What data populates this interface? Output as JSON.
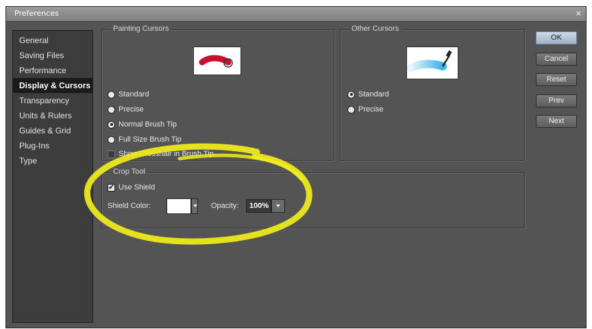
{
  "window": {
    "title": "Preferences",
    "close_glyph": "×"
  },
  "sidebar": {
    "items": [
      {
        "label": "General"
      },
      {
        "label": "Saving Files"
      },
      {
        "label": "Performance"
      },
      {
        "label": "Display & Cursors",
        "selected": true
      },
      {
        "label": "Transparency"
      },
      {
        "label": "Units & Rulers"
      },
      {
        "label": "Guides & Grid"
      },
      {
        "label": "Plug-Ins"
      },
      {
        "label": "Type"
      }
    ]
  },
  "painting_cursors": {
    "legend": "Painting Cursors",
    "options": [
      {
        "label": "Standard",
        "checked": false
      },
      {
        "label": "Precise",
        "checked": false
      },
      {
        "label": "Normal Brush Tip",
        "checked": true
      },
      {
        "label": "Full Size Brush Tip",
        "checked": false
      }
    ],
    "crosshair_label": "Show Crosshair in Brush Tip",
    "crosshair_checked": false
  },
  "other_cursors": {
    "legend": "Other Cursors",
    "options": [
      {
        "label": "Standard",
        "checked": true
      },
      {
        "label": "Precise",
        "checked": false
      }
    ]
  },
  "crop_tool": {
    "legend": "Crop Tool",
    "use_shield_label": "Use Shield",
    "use_shield_checked": true,
    "shield_color_label": "Shield Color:",
    "shield_color": "#ffffff",
    "opacity_label": "Opacity:",
    "opacity_value": "100%"
  },
  "buttons": {
    "ok": "OK",
    "cancel": "Cancel",
    "reset": "Reset",
    "prev": "Prev",
    "next": "Next"
  },
  "colors": {
    "dialog_bg": "#545454",
    "annotation": "#f2ee1c",
    "brush_stroke": "#c8102e",
    "eyedropper_stroke": "#3bb2e6"
  },
  "icons": {
    "painting_preview": "brush-cursor-icon",
    "other_preview": "eyedropper-icon"
  }
}
